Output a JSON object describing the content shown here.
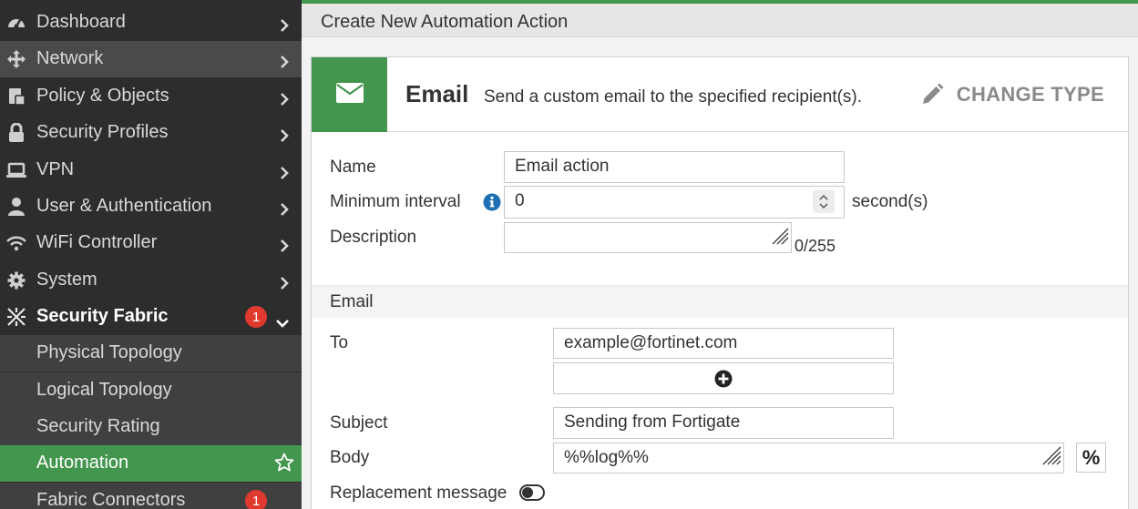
{
  "sidebar": {
    "items": [
      {
        "label": "Dashboard",
        "icon": "dashboard-icon"
      },
      {
        "label": "Network",
        "icon": "network-icon"
      },
      {
        "label": "Policy & Objects",
        "icon": "policy-icon"
      },
      {
        "label": "Security Profiles",
        "icon": "lock-icon"
      },
      {
        "label": "VPN",
        "icon": "laptop-icon"
      },
      {
        "label": "User & Authentication",
        "icon": "user-icon"
      },
      {
        "label": "WiFi Controller",
        "icon": "wifi-icon"
      },
      {
        "label": "System",
        "icon": "gear-icon"
      },
      {
        "label": "Security Fabric",
        "icon": "security-fabric-icon",
        "badge": "1"
      }
    ],
    "sub_items": [
      {
        "label": "Physical Topology"
      },
      {
        "label": "Logical Topology"
      },
      {
        "label": "Security Rating"
      },
      {
        "label": "Automation"
      },
      {
        "label": "Fabric Connectors",
        "badge": "1"
      }
    ],
    "accent_color": "#43964e",
    "badge_color": "#e03a2f"
  },
  "page": {
    "title": "Create New Automation Action"
  },
  "action_type": {
    "name": "Email",
    "description": "Send a custom email to the specified recipient(s).",
    "change_type_label": "CHANGE TYPE",
    "icon": "envelope-icon"
  },
  "form": {
    "name_label": "Name",
    "name_value": "Email action",
    "min_interval_label": "Minimum interval",
    "min_interval_value": "0",
    "min_interval_unit": "second(s)",
    "description_label": "Description",
    "description_value": "",
    "description_counter": "0/255",
    "email_section_label": "Email",
    "to_label": "To",
    "to_value": "example@fortinet.com",
    "subject_label": "Subject",
    "subject_value": "Sending from Fortigate",
    "body_label": "Body",
    "body_value": "%%log%%",
    "percent_button_label": "%",
    "replacement_message_label": "Replacement message",
    "replacement_message_enabled": false
  }
}
